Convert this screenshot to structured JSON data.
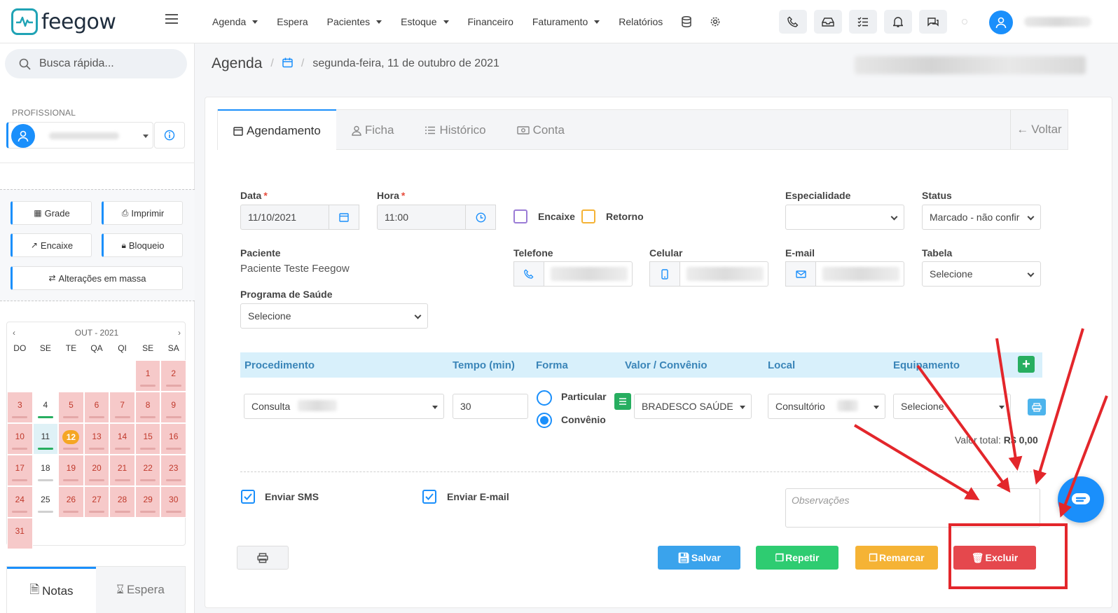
{
  "app": {
    "logo_text": "feegow"
  },
  "nav": {
    "items": [
      {
        "label": "Agenda",
        "dropdown": true
      },
      {
        "label": "Espera",
        "dropdown": false
      },
      {
        "label": "Pacientes",
        "dropdown": true
      },
      {
        "label": "Estoque",
        "dropdown": true
      },
      {
        "label": "Financeiro",
        "dropdown": false
      },
      {
        "label": "Faturamento",
        "dropdown": true
      },
      {
        "label": "Relatórios",
        "dropdown": false
      }
    ],
    "icons": [
      "database-icon",
      "gear-icon"
    ],
    "toolbar_icons": [
      "phone-icon",
      "inbox-icon",
      "checklist-icon",
      "bell-icon",
      "chat-icon"
    ]
  },
  "sidebar": {
    "search_placeholder": "Busca rápida...",
    "professional_label": "PROFISSIONAL",
    "buttons": {
      "grade": "Grade",
      "imprimir": "Imprimir",
      "encaixe": "Encaixe",
      "bloqueio": "Bloqueio",
      "alteracoes": "Alterações em massa"
    },
    "calendar": {
      "month_label": "OUT - 2021",
      "dow": [
        "DO",
        "SE",
        "TE",
        "QA",
        "QI",
        "SE",
        "SA"
      ],
      "days": [
        "",
        "",
        "",
        "",
        "",
        "1",
        "2",
        "3",
        "4",
        "5",
        "6",
        "7",
        "8",
        "9",
        "10",
        "11",
        "12",
        "13",
        "14",
        "15",
        "16",
        "17",
        "18",
        "19",
        "20",
        "21",
        "22",
        "23",
        "24",
        "25",
        "26",
        "27",
        "28",
        "29",
        "30",
        "31"
      ],
      "highlighted_day": "12",
      "selected_day": "11"
    },
    "tabs": {
      "notas": "Notas",
      "espera": "Espera"
    }
  },
  "breadcrumb": {
    "title": "Agenda",
    "date": "segunda-feira, 11 de outubro de 2021"
  },
  "tabs": {
    "agendamento": "Agendamento",
    "ficha": "Ficha",
    "historico": "Histórico",
    "conta": "Conta",
    "voltar": "Voltar"
  },
  "form": {
    "data_label": "Data",
    "data_value": "11/10/2021",
    "hora_label": "Hora",
    "hora_value": "11:00",
    "encaixe_label": "Encaixe",
    "retorno_label": "Retorno",
    "especialidade_label": "Especialidade",
    "status_label": "Status",
    "status_value": "Marcado - não confir",
    "paciente_label": "Paciente",
    "paciente_value": "Paciente Teste Feegow",
    "telefone_label": "Telefone",
    "celular_label": "Celular",
    "email_label": "E-mail",
    "tabela_label": "Tabela",
    "tabela_value": "Selecione",
    "programa_label": "Programa de Saúde",
    "programa_value": "Selecione"
  },
  "procedure": {
    "headers": {
      "procedimento": "Procedimento",
      "tempo": "Tempo (min)",
      "forma": "Forma",
      "valor": "Valor / Convênio",
      "local": "Local",
      "equipamento": "Equipamento"
    },
    "procedimento_value": "Consulta",
    "tempo_value": "30",
    "forma_particular": "Particular",
    "forma_convenio": "Convênio",
    "convenio_value": "BRADESCO SAÚDE",
    "local_value": "Consultório",
    "equipamento_value": "Selecione",
    "total_label": "Valor total:",
    "total_value": "R$ 0,00"
  },
  "options": {
    "sms_label": "Enviar SMS",
    "email_label": "Enviar E-mail",
    "obs_placeholder": "Observações"
  },
  "actions": {
    "salvar": "Salvar",
    "repetir": "Repetir",
    "remarcar": "Remarcar",
    "excluir": "Excluir"
  },
  "colors": {
    "primary": "#1a8ffb",
    "salvar": "#3aa3ec",
    "repetir": "#2ecc71",
    "remarcar": "#f5b335",
    "excluir": "#e5484d",
    "annotation": "#e3262b"
  }
}
